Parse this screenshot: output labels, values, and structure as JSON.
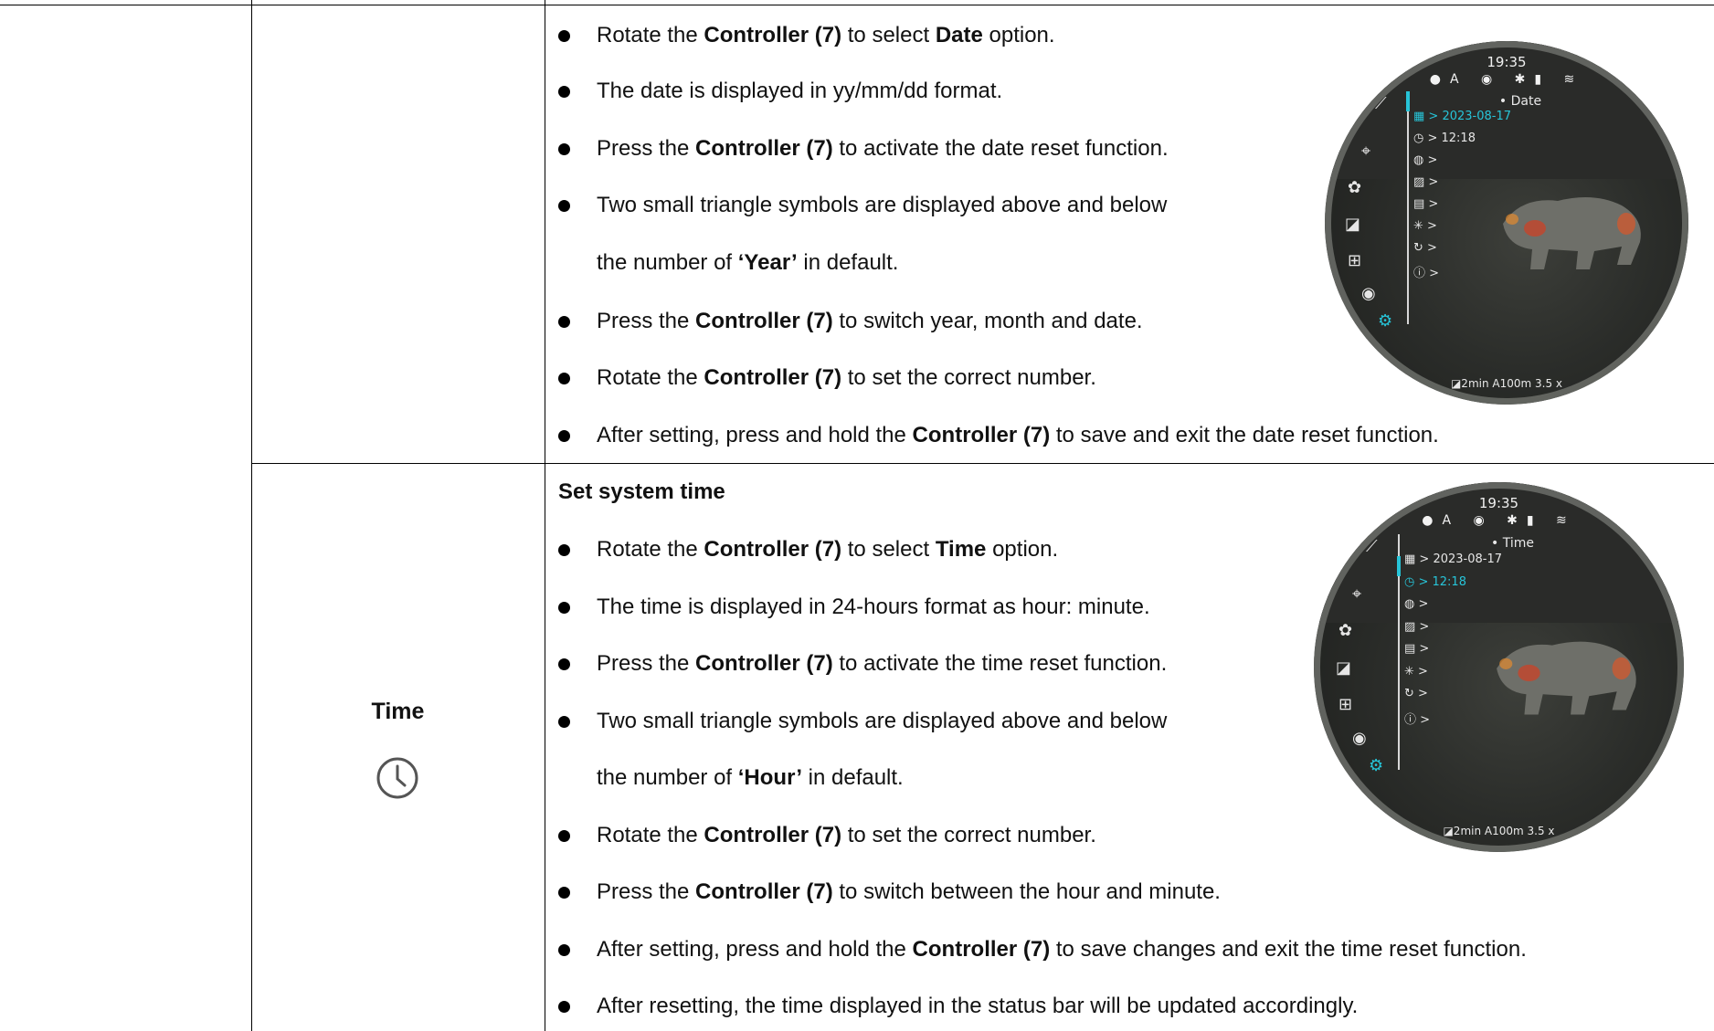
{
  "date_section": {
    "lines": [
      [
        "Rotate the ",
        "Controller (7)",
        " to select ",
        "Date",
        " option."
      ],
      [
        "The date is displayed in yy/mm/dd format."
      ],
      [
        "Press the ",
        "Controller (7)",
        " to activate the date reset function."
      ],
      [
        "Two small triangle symbols are displayed above and below"
      ],
      [
        "the number of ",
        "‘Year’",
        " in default."
      ],
      [
        "Press the ",
        "Controller (7)",
        " to switch year, month and date."
      ],
      [
        "Rotate the ",
        "Controller (7)",
        " to set the correct number."
      ],
      [
        "After setting, press and hold the ",
        "Controller (7)",
        " to save and exit the date reset function."
      ]
    ],
    "screen": {
      "clock": "19:35",
      "status_icons": "●A ◉ ✱▮ ≋",
      "menu_title": "• Date",
      "rows": [
        "2023-08-17",
        "12:18",
        "",
        "",
        "",
        "",
        "",
        ""
      ],
      "row_icons": [
        "▦ >",
        "◷ >",
        "◍ >",
        "▨ >",
        "▤ >",
        "✳ >",
        "↻ >",
        "ⓘ >"
      ],
      "bottom": "◪2min   A100m   3.5 x"
    }
  },
  "time_section": {
    "param_label": "Time",
    "heading": "Set system time",
    "lines": [
      [
        "Rotate the ",
        "Controller (7)",
        " to select ",
        "Time",
        " option."
      ],
      [
        "The time is displayed in 24-hours format as hour: minute."
      ],
      [
        "Press the ",
        "Controller (7)",
        " to activate the time reset function."
      ],
      [
        "Two small triangle symbols are displayed above and below"
      ],
      [
        "the number of ",
        "‘Hour’",
        " in default."
      ],
      [
        "Rotate the ",
        "Controller (7)",
        " to set the correct number."
      ],
      [
        "Press the ",
        "Controller (7)",
        " to switch between the hour and minute."
      ],
      [
        "After setting, press and hold the ",
        "Controller (7)",
        " to save changes and exit the time reset function."
      ],
      [
        "After resetting, the time displayed in the status bar will be updated accordingly."
      ]
    ],
    "screen": {
      "clock": "19:35",
      "status_icons": "●A ◉ ✱▮ ≋",
      "menu_title": "• Time",
      "rows": [
        "2023-08-17",
        "12:18",
        "",
        "",
        "",
        "",
        "",
        ""
      ],
      "row_icons": [
        "▦ >",
        "◷ >",
        "◍ >",
        "▨ >",
        "▤ >",
        "✳ >",
        "↻ >",
        "ⓘ >"
      ],
      "bottom": "◪2min   A100m   3.5 x"
    }
  },
  "colors": {
    "accent": "#27c4d8",
    "rule": "#000000"
  }
}
